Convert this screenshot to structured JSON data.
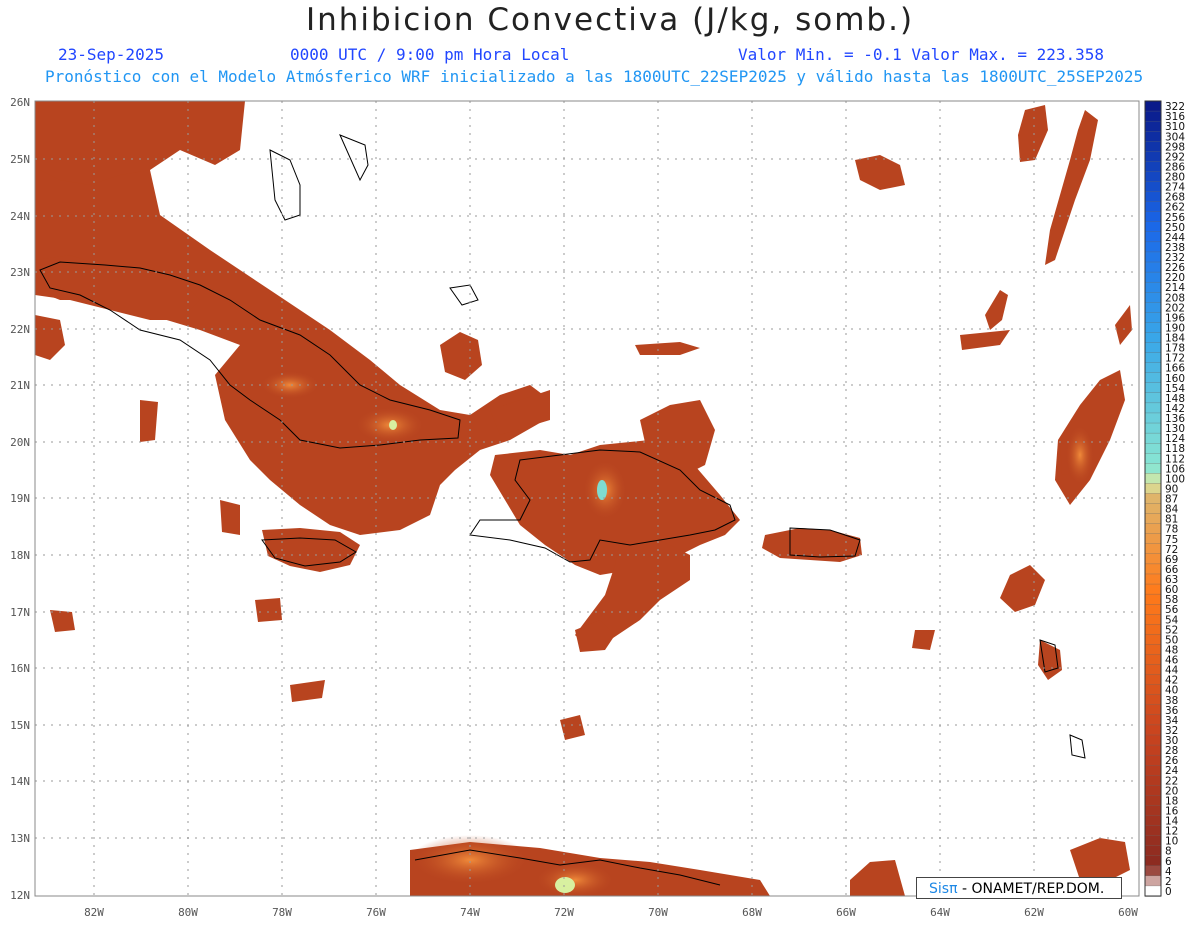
{
  "title": "Inhibicion Convectiva (J/kg, somb.)",
  "date": "23-Sep-2025",
  "time": "0000 UTC / 9:00 pm Hora Local",
  "minmax": "Valor Min. = -0.1  Valor Max. = 223.358",
  "forecast": "Pronóstico con el Modelo Atmósferico WRF inicializado a las 1800UTC_22SEP2025 y válido hasta las  1800UTC_25SEP2025",
  "credit": {
    "logo": "Sisπ",
    "text": " - ONAMET/REP.DOM."
  },
  "lat_labels": [
    "26N",
    "25N",
    "24N",
    "23N",
    "22N",
    "21N",
    "20N",
    "19N",
    "18N",
    "17N",
    "16N",
    "15N",
    "14N",
    "13N",
    "12N"
  ],
  "lon_labels": [
    "82W",
    "80W",
    "78W",
    "76W",
    "74W",
    "72W",
    "70W",
    "68W",
    "66W",
    "64W",
    "62W",
    "60W"
  ],
  "colorbar_labels": [
    "322",
    "316",
    "310",
    "304",
    "298",
    "292",
    "286",
    "280",
    "274",
    "268",
    "262",
    "256",
    "250",
    "244",
    "238",
    "232",
    "226",
    "220",
    "214",
    "208",
    "202",
    "196",
    "190",
    "184",
    "178",
    "172",
    "166",
    "160",
    "154",
    "148",
    "142",
    "136",
    "130",
    "124",
    "118",
    "112",
    "106",
    "100",
    "90",
    "87",
    "84",
    "81",
    "78",
    "75",
    "72",
    "69",
    "66",
    "63",
    "60",
    "58",
    "56",
    "54",
    "52",
    "50",
    "48",
    "46",
    "44",
    "42",
    "40",
    "38",
    "36",
    "34",
    "32",
    "30",
    "28",
    "26",
    "24",
    "22",
    "20",
    "18",
    "16",
    "14",
    "12",
    "10",
    "8",
    "6",
    "4",
    "2",
    "0"
  ],
  "colors": {
    "cin_fill": "#b8441f",
    "cin_hot": "#e06a2a",
    "cin_peak": "#7fdcd0",
    "coast": "#000000",
    "grid": "#9a9a9a"
  }
}
